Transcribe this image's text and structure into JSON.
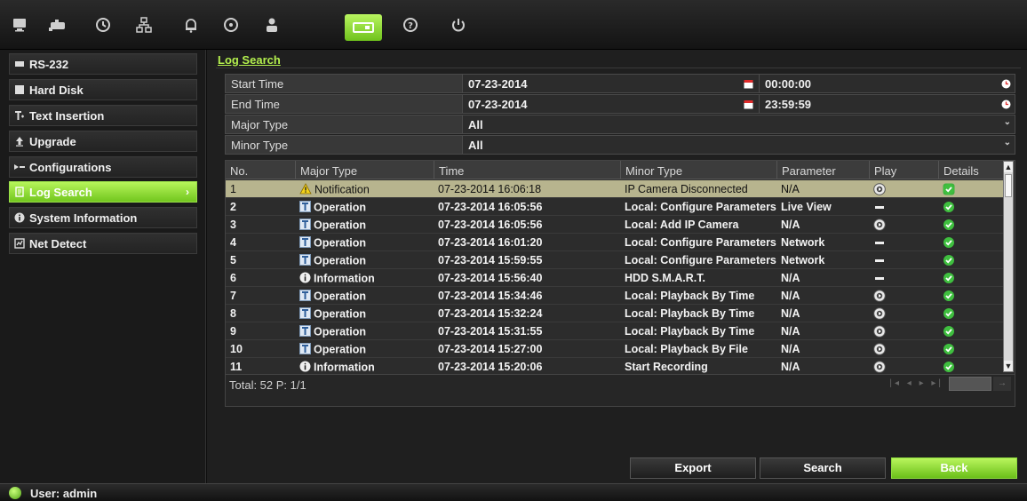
{
  "toolbar": {
    "items": [
      {
        "icon": "monitor-icon"
      },
      {
        "icon": "camera-icon"
      },
      {
        "icon": "clock-icon"
      },
      {
        "icon": "network-icon"
      },
      {
        "icon": "bell-icon"
      },
      {
        "icon": "hdd-icon"
      },
      {
        "icon": "user-icon"
      },
      {
        "icon": "device-icon",
        "active": true
      },
      {
        "icon": "help-icon"
      },
      {
        "icon": "power-icon"
      }
    ]
  },
  "sidebar": {
    "items": [
      {
        "label": "RS-232",
        "icon": "rs232-icon"
      },
      {
        "label": "Hard Disk",
        "icon": "hard-disk-icon"
      },
      {
        "label": "Text Insertion",
        "icon": "text-insertion-icon"
      },
      {
        "label": "Upgrade",
        "icon": "upgrade-icon"
      },
      {
        "label": "Configurations",
        "icon": "configurations-icon"
      },
      {
        "label": "Log Search",
        "icon": "log-search-icon",
        "active": true
      },
      {
        "label": "System Information",
        "icon": "info-icon"
      },
      {
        "label": "Net Detect",
        "icon": "net-detect-icon"
      }
    ]
  },
  "page": {
    "title": "Log Search"
  },
  "form": {
    "start_time_label": "Start Time",
    "start_date": "07-23-2014",
    "start_clock": "00:00:00",
    "end_time_label": "End Time",
    "end_date": "07-23-2014",
    "end_clock": "23:59:59",
    "major_type_label": "Major Type",
    "major_type_value": "All",
    "minor_type_label": "Minor Type",
    "minor_type_value": "All"
  },
  "table": {
    "headers": [
      "No.",
      "Major Type",
      "Time",
      "Minor Type",
      "Parameter",
      "Play",
      "Details"
    ],
    "rows": [
      {
        "no": "1",
        "major": "Notification",
        "major_icon": "warning",
        "time": "07-23-2014 16:06:18",
        "minor": "IP Camera Disconnected",
        "param": "N/A",
        "play": "play",
        "selected": true
      },
      {
        "no": "2",
        "major": "Operation",
        "major_icon": "operation",
        "time": "07-23-2014 16:05:56",
        "minor": "Local: Configure Parameters",
        "param": "Live View",
        "play": "none"
      },
      {
        "no": "3",
        "major": "Operation",
        "major_icon": "operation",
        "time": "07-23-2014 16:05:56",
        "minor": "Local: Add IP Camera",
        "param": "N/A",
        "play": "play"
      },
      {
        "no": "4",
        "major": "Operation",
        "major_icon": "operation",
        "time": "07-23-2014 16:01:20",
        "minor": "Local: Configure Parameters",
        "param": "Network",
        "play": "none"
      },
      {
        "no": "5",
        "major": "Operation",
        "major_icon": "operation",
        "time": "07-23-2014 15:59:55",
        "minor": "Local: Configure Parameters",
        "param": "Network",
        "play": "none"
      },
      {
        "no": "6",
        "major": "Information",
        "major_icon": "information",
        "time": "07-23-2014 15:56:40",
        "minor": "HDD S.M.A.R.T.",
        "param": "N/A",
        "play": "none"
      },
      {
        "no": "7",
        "major": "Operation",
        "major_icon": "operation",
        "time": "07-23-2014 15:34:46",
        "minor": "Local: Playback By Time",
        "param": "N/A",
        "play": "play"
      },
      {
        "no": "8",
        "major": "Operation",
        "major_icon": "operation",
        "time": "07-23-2014 15:32:24",
        "minor": "Local: Playback By Time",
        "param": "N/A",
        "play": "play"
      },
      {
        "no": "9",
        "major": "Operation",
        "major_icon": "operation",
        "time": "07-23-2014 15:31:55",
        "minor": "Local: Playback By Time",
        "param": "N/A",
        "play": "play"
      },
      {
        "no": "10",
        "major": "Operation",
        "major_icon": "operation",
        "time": "07-23-2014 15:27:00",
        "minor": "Local: Playback By File",
        "param": "N/A",
        "play": "play"
      },
      {
        "no": "11",
        "major": "Information",
        "major_icon": "information",
        "time": "07-23-2014 15:20:06",
        "minor": "Start Recording",
        "param": "N/A",
        "play": "play"
      }
    ],
    "total_label": "Total: 52  P: 1/1"
  },
  "buttons": {
    "export": "Export",
    "search": "Search",
    "back": "Back"
  },
  "status": {
    "user_label": "User: admin"
  },
  "colors": {
    "accent": "#8ed43a",
    "selected_row": "#b7b48e"
  }
}
